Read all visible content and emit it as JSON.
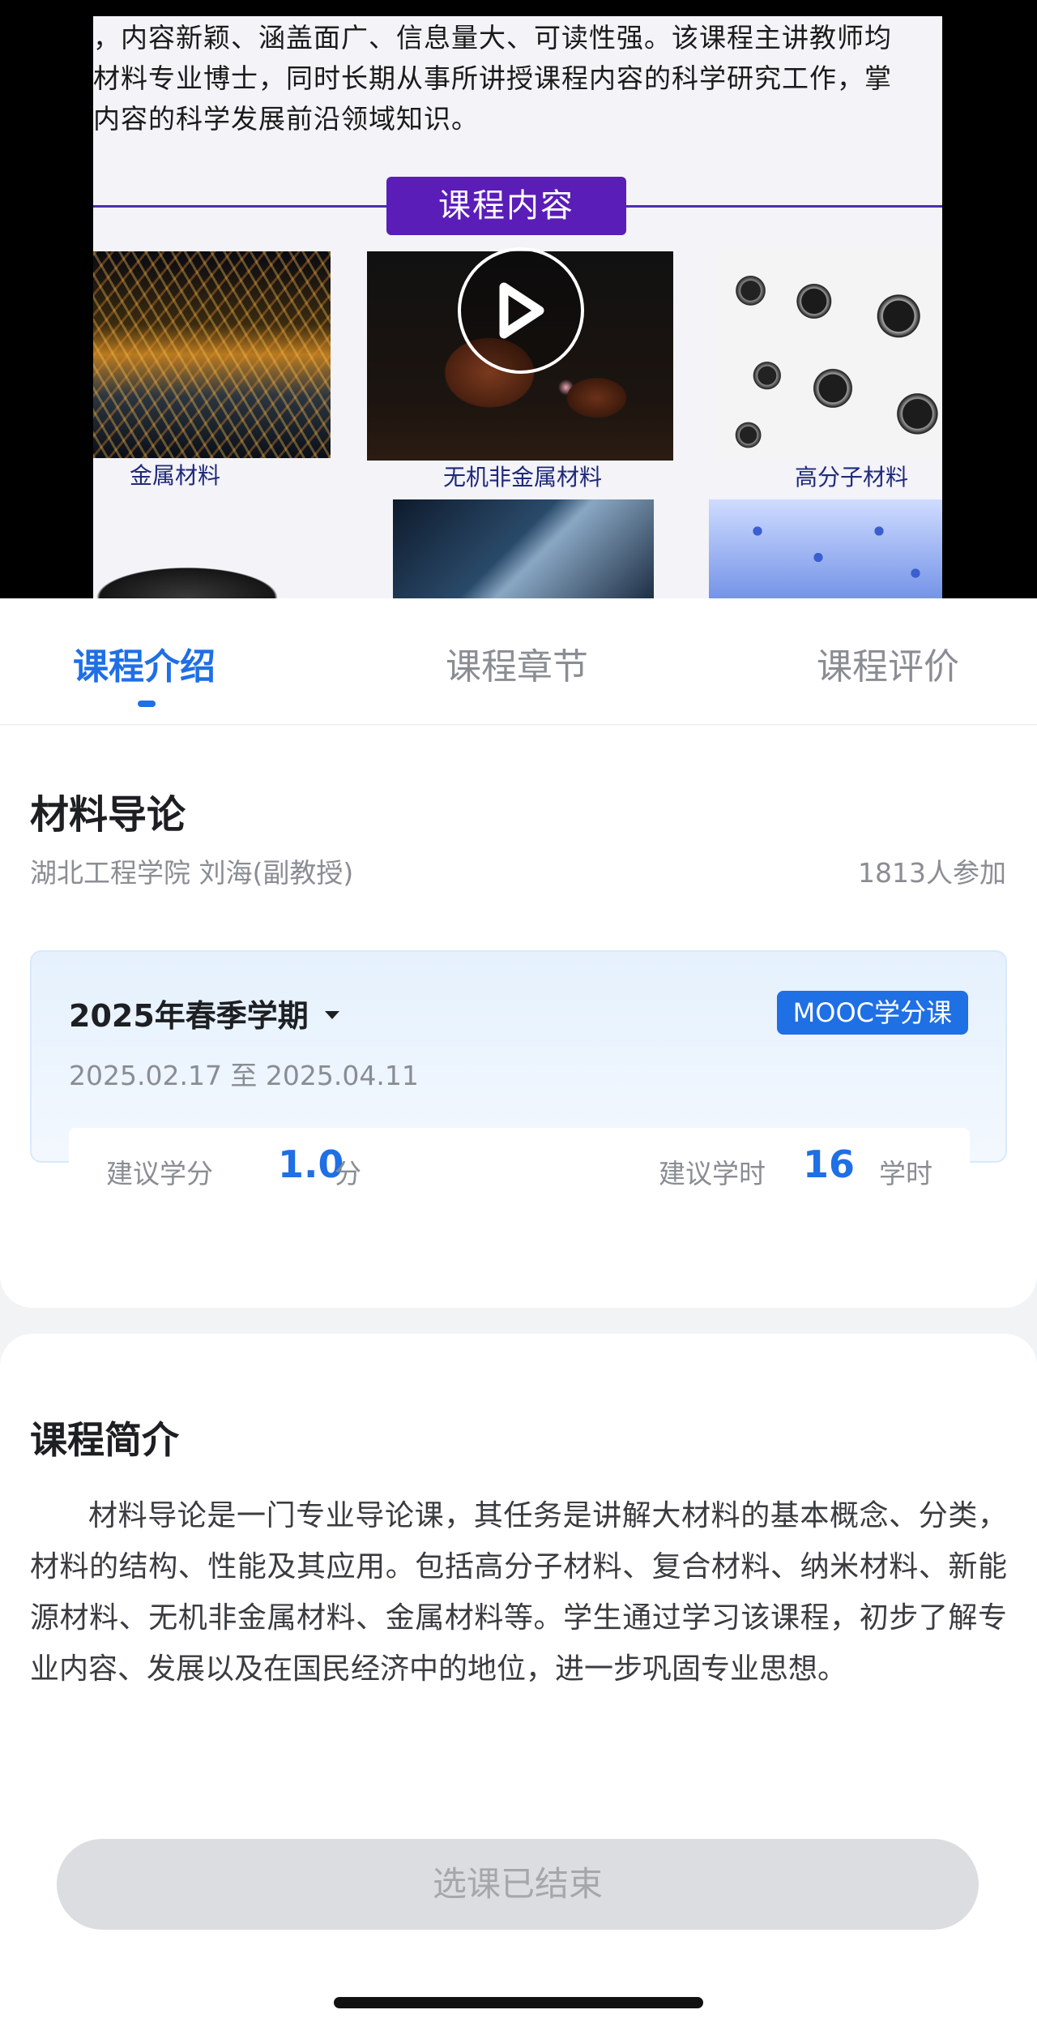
{
  "video": {
    "slide_text": [
      "，内容新颖、涵盖面广、信息量大、可读性强。该课程主讲教师均",
      "材料专业博士，同时长期从事所讲授课程内容的科学研究工作，掌",
      "内容的科学发展前沿领域知识。"
    ],
    "banner": "课程内容",
    "labels": [
      "金属材料",
      "无机非金属材料",
      "高分子材料"
    ]
  },
  "tabs": [
    {
      "label": "课程介绍",
      "active": true
    },
    {
      "label": "课程章节",
      "active": false
    },
    {
      "label": "课程评价",
      "active": false
    }
  ],
  "course": {
    "title": "材料导论",
    "teacher": "湖北工程学院 刘海(副教授)",
    "participants": "1813人参加",
    "term": {
      "name": "2025年春季学期",
      "badge": "MOOC学分课",
      "dates": "2025.02.17 至 2025.04.11",
      "credit_label": "建议学分",
      "credit_value": "1.0",
      "credit_unit": "分",
      "hours_label": "建议学时",
      "hours_value": "16",
      "hours_unit": "学时"
    }
  },
  "intro": {
    "title": "课程简介",
    "text": "材料导论是一门专业导论课，其任务是讲解大材料的基本概念、分类，材料的结构、性能及其应用。包括高分子材料、复合材料、纳米材料、新能源材料、无机非金属材料、金属材料等。学生通过学习该课程，初步了解专业内容、发展以及在国民经济中的地位，进一步巩固专业思想。"
  },
  "enroll_button": "选课已结束",
  "colors": {
    "accent": "#1f6fe5",
    "banner": "#5a1db8"
  }
}
